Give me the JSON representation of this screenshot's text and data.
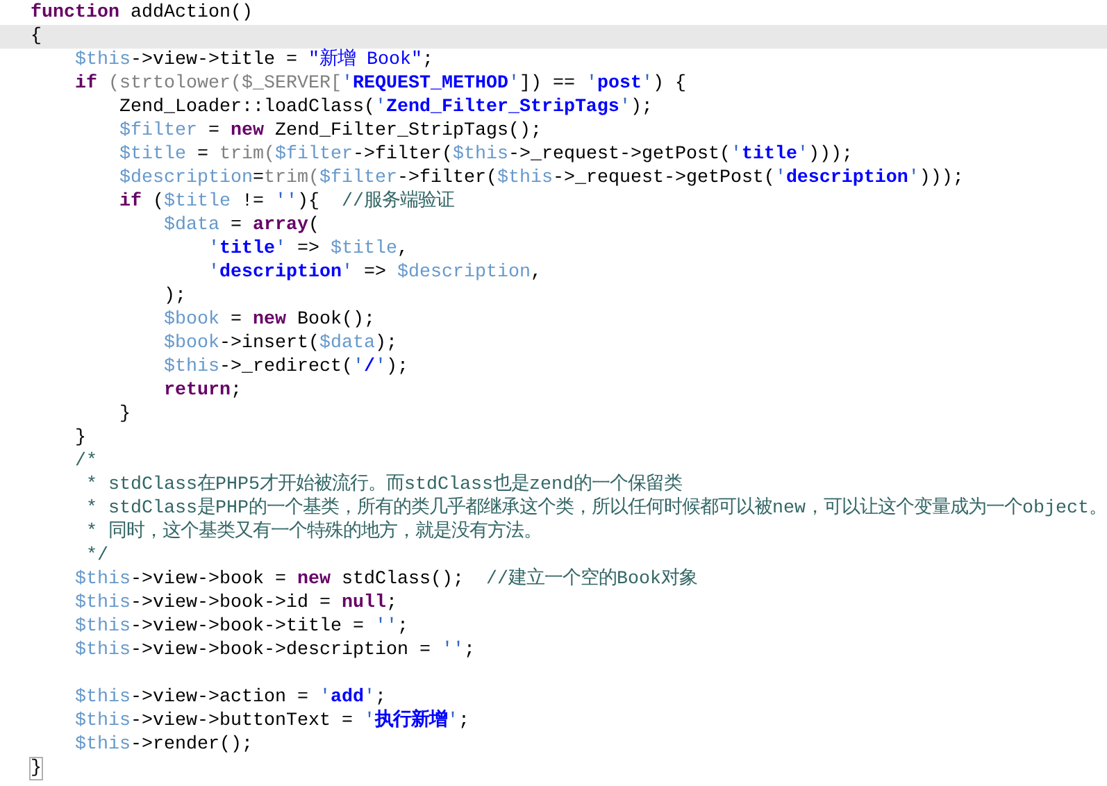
{
  "editor": {
    "lines": [
      {
        "current": false,
        "tokens": [
          {
            "kind": "keyword",
            "text": "function"
          },
          {
            "kind": "plain",
            "text": " addAction()"
          }
        ]
      },
      {
        "current": true,
        "tokens": [
          {
            "kind": "plain",
            "text": "{"
          }
        ]
      },
      {
        "current": false,
        "tokens": [
          {
            "kind": "variable",
            "text": "    $this"
          },
          {
            "kind": "plain",
            "text": "->view->title = "
          },
          {
            "kind": "dstring",
            "text": "\"新增 Book\""
          },
          {
            "kind": "plain",
            "text": ";"
          }
        ]
      },
      {
        "current": false,
        "tokens": [
          {
            "kind": "keyword",
            "text": "    if"
          },
          {
            "kind": "builtin",
            "text": " (strtolower($_SERVER["
          },
          {
            "kind": "quote",
            "text": "'"
          },
          {
            "kind": "string",
            "text": "REQUEST_METHOD"
          },
          {
            "kind": "quote",
            "text": "'"
          },
          {
            "kind": "plain",
            "text": "]) == "
          },
          {
            "kind": "quote",
            "text": "'"
          },
          {
            "kind": "string",
            "text": "post"
          },
          {
            "kind": "quote",
            "text": "'"
          },
          {
            "kind": "plain",
            "text": ") {"
          }
        ]
      },
      {
        "current": false,
        "tokens": [
          {
            "kind": "plain",
            "text": "        Zend_Loader::loadClass("
          },
          {
            "kind": "quote",
            "text": "'"
          },
          {
            "kind": "string",
            "text": "Zend_Filter_StripTags"
          },
          {
            "kind": "quote",
            "text": "'"
          },
          {
            "kind": "plain",
            "text": ");"
          }
        ]
      },
      {
        "current": false,
        "tokens": [
          {
            "kind": "variable",
            "text": "        $filter"
          },
          {
            "kind": "plain",
            "text": " = "
          },
          {
            "kind": "keyword",
            "text": "new"
          },
          {
            "kind": "plain",
            "text": " Zend_Filter_StripTags();"
          }
        ]
      },
      {
        "current": false,
        "tokens": [
          {
            "kind": "variable",
            "text": "        $title"
          },
          {
            "kind": "plain",
            "text": " = "
          },
          {
            "kind": "builtin",
            "text": "trim("
          },
          {
            "kind": "variable",
            "text": "$filter"
          },
          {
            "kind": "plain",
            "text": "->filter("
          },
          {
            "kind": "variable",
            "text": "$this"
          },
          {
            "kind": "plain",
            "text": "->_request->getPost("
          },
          {
            "kind": "quote",
            "text": "'"
          },
          {
            "kind": "string",
            "text": "title"
          },
          {
            "kind": "quote",
            "text": "'"
          },
          {
            "kind": "plain",
            "text": ")));"
          }
        ]
      },
      {
        "current": false,
        "tokens": [
          {
            "kind": "variable",
            "text": "        $description"
          },
          {
            "kind": "plain",
            "text": "="
          },
          {
            "kind": "builtin",
            "text": "trim("
          },
          {
            "kind": "variable",
            "text": "$filter"
          },
          {
            "kind": "plain",
            "text": "->filter("
          },
          {
            "kind": "variable",
            "text": "$this"
          },
          {
            "kind": "plain",
            "text": "->_request->getPost("
          },
          {
            "kind": "quote",
            "text": "'"
          },
          {
            "kind": "string",
            "text": "description"
          },
          {
            "kind": "quote",
            "text": "'"
          },
          {
            "kind": "plain",
            "text": ")));"
          }
        ]
      },
      {
        "current": false,
        "tokens": [
          {
            "kind": "keyword",
            "text": "        if"
          },
          {
            "kind": "plain",
            "text": " ("
          },
          {
            "kind": "variable",
            "text": "$title"
          },
          {
            "kind": "plain",
            "text": " != "
          },
          {
            "kind": "quote",
            "text": "''"
          },
          {
            "kind": "plain",
            "text": "){  "
          },
          {
            "kind": "comment",
            "text": "//服务端验证"
          }
        ]
      },
      {
        "current": false,
        "tokens": [
          {
            "kind": "variable",
            "text": "            $data"
          },
          {
            "kind": "plain",
            "text": " = "
          },
          {
            "kind": "keyword",
            "text": "array"
          },
          {
            "kind": "plain",
            "text": "("
          }
        ]
      },
      {
        "current": false,
        "tokens": [
          {
            "kind": "quote",
            "text": "                '"
          },
          {
            "kind": "string",
            "text": "title"
          },
          {
            "kind": "quote",
            "text": "'"
          },
          {
            "kind": "plain",
            "text": " => "
          },
          {
            "kind": "variable",
            "text": "$title"
          },
          {
            "kind": "plain",
            "text": ","
          }
        ]
      },
      {
        "current": false,
        "tokens": [
          {
            "kind": "quote",
            "text": "                '"
          },
          {
            "kind": "string",
            "text": "description"
          },
          {
            "kind": "quote",
            "text": "'"
          },
          {
            "kind": "plain",
            "text": " => "
          },
          {
            "kind": "variable",
            "text": "$description"
          },
          {
            "kind": "plain",
            "text": ","
          }
        ]
      },
      {
        "current": false,
        "tokens": [
          {
            "kind": "plain",
            "text": "            );"
          }
        ]
      },
      {
        "current": false,
        "tokens": [
          {
            "kind": "variable",
            "text": "            $book"
          },
          {
            "kind": "plain",
            "text": " = "
          },
          {
            "kind": "keyword",
            "text": "new"
          },
          {
            "kind": "plain",
            "text": " Book();"
          }
        ]
      },
      {
        "current": false,
        "tokens": [
          {
            "kind": "variable",
            "text": "            $book"
          },
          {
            "kind": "plain",
            "text": "->insert("
          },
          {
            "kind": "variable",
            "text": "$data"
          },
          {
            "kind": "plain",
            "text": ");"
          }
        ]
      },
      {
        "current": false,
        "tokens": [
          {
            "kind": "variable",
            "text": "            $this"
          },
          {
            "kind": "plain",
            "text": "->_redirect("
          },
          {
            "kind": "quote",
            "text": "'"
          },
          {
            "kind": "string",
            "text": "/"
          },
          {
            "kind": "quote",
            "text": "'"
          },
          {
            "kind": "plain",
            "text": ");"
          }
        ]
      },
      {
        "current": false,
        "tokens": [
          {
            "kind": "keyword",
            "text": "            return"
          },
          {
            "kind": "plain",
            "text": ";"
          }
        ]
      },
      {
        "current": false,
        "tokens": [
          {
            "kind": "plain",
            "text": "        }"
          }
        ]
      },
      {
        "current": false,
        "tokens": [
          {
            "kind": "plain",
            "text": "    }"
          }
        ]
      },
      {
        "current": false,
        "tokens": [
          {
            "kind": "comment",
            "text": "    /*"
          }
        ]
      },
      {
        "current": false,
        "tokens": [
          {
            "kind": "comment",
            "text": "     * stdClass在PHP5才开始被流行。而stdClass也是zend的一个保留类"
          }
        ]
      },
      {
        "current": false,
        "tokens": [
          {
            "kind": "comment",
            "text": "     * stdClass是PHP的一个基类，所有的类几乎都继承这个类，所以任何时候都可以被new，可以让这个变量成为一个object。"
          }
        ]
      },
      {
        "current": false,
        "tokens": [
          {
            "kind": "comment",
            "text": "     * 同时，这个基类又有一个特殊的地方，就是没有方法。"
          }
        ]
      },
      {
        "current": false,
        "tokens": [
          {
            "kind": "comment",
            "text": "     */"
          }
        ]
      },
      {
        "current": false,
        "tokens": [
          {
            "kind": "variable",
            "text": "    $this"
          },
          {
            "kind": "plain",
            "text": "->view->book = "
          },
          {
            "kind": "keyword",
            "text": "new"
          },
          {
            "kind": "plain",
            "text": " stdClass();  "
          },
          {
            "kind": "comment",
            "text": "//建立一个空的Book对象"
          }
        ]
      },
      {
        "current": false,
        "tokens": [
          {
            "kind": "variable",
            "text": "    $this"
          },
          {
            "kind": "plain",
            "text": "->view->book->id = "
          },
          {
            "kind": "keyword",
            "text": "null"
          },
          {
            "kind": "plain",
            "text": ";"
          }
        ]
      },
      {
        "current": false,
        "tokens": [
          {
            "kind": "variable",
            "text": "    $this"
          },
          {
            "kind": "plain",
            "text": "->view->book->title = "
          },
          {
            "kind": "quote",
            "text": "''"
          },
          {
            "kind": "plain",
            "text": ";"
          }
        ]
      },
      {
        "current": false,
        "tokens": [
          {
            "kind": "variable",
            "text": "    $this"
          },
          {
            "kind": "plain",
            "text": "->view->book->description = "
          },
          {
            "kind": "quote",
            "text": "''"
          },
          {
            "kind": "plain",
            "text": ";"
          }
        ]
      },
      {
        "current": false
      },
      {
        "current": false,
        "tokens": [
          {
            "kind": "variable",
            "text": "    $this"
          },
          {
            "kind": "plain",
            "text": "->view->action = "
          },
          {
            "kind": "quote",
            "text": "'"
          },
          {
            "kind": "string",
            "text": "add"
          },
          {
            "kind": "quote",
            "text": "'"
          },
          {
            "kind": "plain",
            "text": ";"
          }
        ]
      },
      {
        "current": false,
        "tokens": [
          {
            "kind": "variable",
            "text": "    $this"
          },
          {
            "kind": "plain",
            "text": "->view->buttonText = "
          },
          {
            "kind": "quote",
            "text": "'"
          },
          {
            "kind": "string",
            "text": "执行新增"
          },
          {
            "kind": "quote",
            "text": "'"
          },
          {
            "kind": "plain",
            "text": ";"
          }
        ]
      },
      {
        "current": false,
        "tokens": [
          {
            "kind": "variable",
            "text": "    $this"
          },
          {
            "kind": "plain",
            "text": "->render();"
          }
        ]
      },
      {
        "current": false,
        "tokens": [
          {
            "kind": "brace_match",
            "text": "}"
          }
        ]
      }
    ]
  }
}
